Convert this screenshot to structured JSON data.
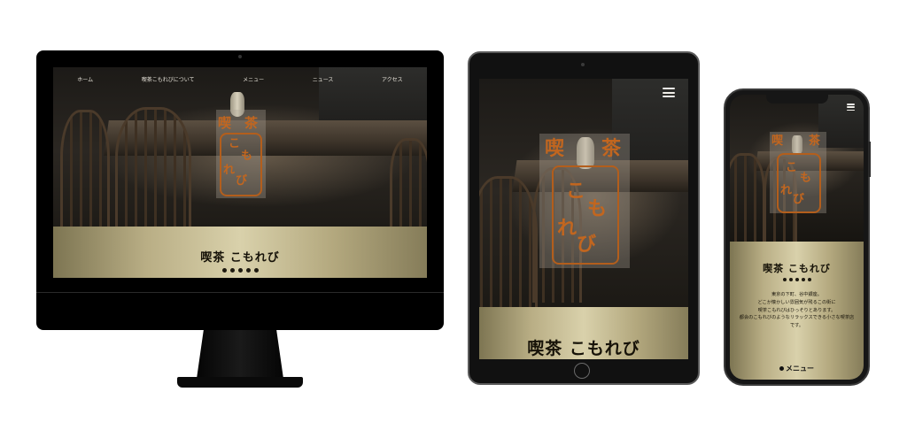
{
  "site": {
    "brand_name": "喫茶 こもれび",
    "logo_chars": [
      "喫",
      "茶",
      "こ",
      "も",
      "れ",
      "び"
    ]
  },
  "desktop": {
    "nav": [
      "ホーム",
      "喫茶こもれびについて",
      "メニュー",
      "ニュース",
      "アクセス"
    ]
  },
  "phone": {
    "intro_lines": [
      "東京の下町、谷中銀座。",
      "どこか懐かしい雰囲気が残るこの街に",
      "喫茶こもれびはひっそりとあります。",
      "都会のこもれびのようなリラックスできる小さな喫茶店",
      "です。"
    ],
    "menu_heading": "メニュー"
  },
  "icons": [
    "hamburger-menu-icon",
    "coffee-bean-icon"
  ],
  "colors": {
    "logo_orange": "#c2661f",
    "gold_band": "#d9d1ab",
    "device_black": "#000000"
  }
}
